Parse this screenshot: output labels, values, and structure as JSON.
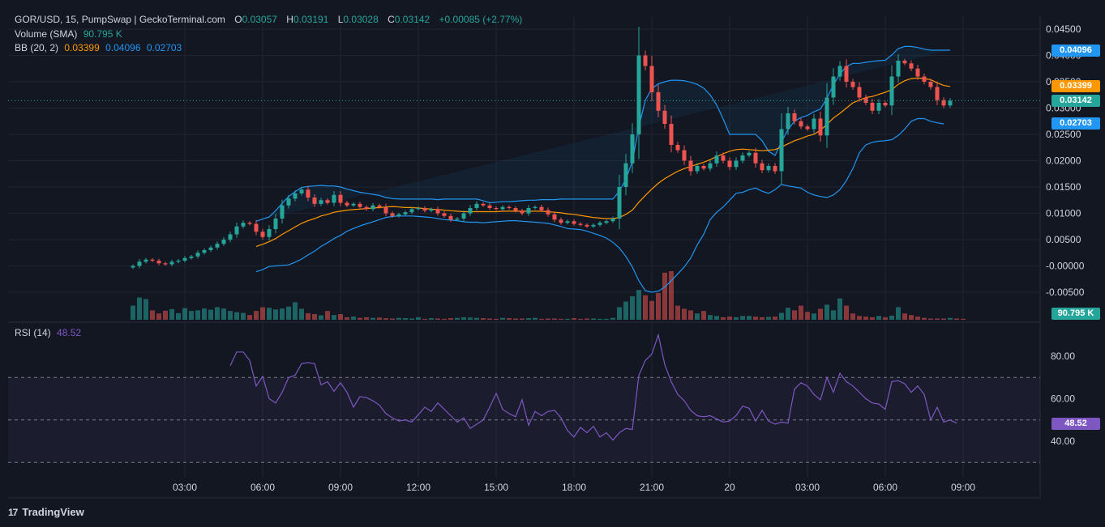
{
  "header": {
    "symbol": "GOR/USD, 15, PumpSwap | GeckoTerminal.com",
    "open_label": "O",
    "open": "0.03057",
    "high_label": "H",
    "high": "0.03191",
    "low_label": "L",
    "low": "0.03028",
    "close_label": "C",
    "close": "0.03142",
    "change": "+0.00085 (+2.77%)"
  },
  "volume_legend": {
    "label": "Volume (SMA)",
    "value": "90.795 K"
  },
  "bb_legend": {
    "label": "BB (20, 2)",
    "basis": "0.03399",
    "upper": "0.04096",
    "lower": "0.02703"
  },
  "rsi_legend": {
    "label": "RSI (14)",
    "value": "48.52"
  },
  "badges": {
    "upper": "0.04096",
    "basis": "0.03399",
    "last": "0.03142",
    "lower": "0.02703",
    "volume": "90.795 K",
    "rsi": "48.52"
  },
  "brand": {
    "name": "TradingView",
    "logo": "17"
  },
  "colors": {
    "up": "#26a69a",
    "down": "#ef5350",
    "bb_band": "#2196f3",
    "bb_basis": "#ff9800",
    "rsi": "#7e57c2",
    "background": "#131722",
    "grid": "#1f2433",
    "text": "#d1d4dc"
  },
  "chart_data": [
    {
      "type": "candlestick",
      "title": "GOR/USD, 15, PumpSwap | GeckoTerminal.com",
      "interval": "15m",
      "ylim": [
        -0.0065,
        0.0465
      ],
      "y_ticks": [
        "0.04500",
        "0.04000",
        "0.03500",
        "0.03000",
        "0.02500",
        "0.02000",
        "0.01500",
        "0.01000",
        "0.00500",
        "-0.00000",
        "-0.00500"
      ],
      "x_ticks": [
        "03:00",
        "06:00",
        "09:00",
        "12:00",
        "15:00",
        "18:00",
        "21:00",
        "20",
        "03:00",
        "06:00",
        "09:00"
      ],
      "x_tick_index": [
        8,
        20,
        32,
        44,
        56,
        68,
        80,
        92,
        104,
        116,
        128
      ],
      "close": [
        0.0,
        0.0008,
        0.0012,
        0.001,
        0.0005,
        0.0003,
        0.0008,
        0.001,
        0.0015,
        0.0018,
        0.0025,
        0.003,
        0.0035,
        0.0042,
        0.005,
        0.006,
        0.0075,
        0.0082,
        0.008,
        0.0065,
        0.0055,
        0.007,
        0.009,
        0.0115,
        0.0128,
        0.0138,
        0.0145,
        0.013,
        0.0118,
        0.0125,
        0.012,
        0.0135,
        0.012,
        0.0115,
        0.0118,
        0.0112,
        0.0108,
        0.0115,
        0.0112,
        0.01,
        0.0095,
        0.0098,
        0.0102,
        0.0108,
        0.011,
        0.0105,
        0.0108,
        0.01,
        0.0095,
        0.0088,
        0.009,
        0.01,
        0.011,
        0.0118,
        0.0115,
        0.011,
        0.0108,
        0.0112,
        0.011,
        0.0105,
        0.01,
        0.011,
        0.0112,
        0.0106,
        0.0098,
        0.0088,
        0.0082,
        0.0085,
        0.008,
        0.0078,
        0.0075,
        0.0078,
        0.0082,
        0.0085,
        0.009,
        0.015,
        0.0195,
        0.025,
        0.04,
        0.038,
        0.033,
        0.0295,
        0.027,
        0.023,
        0.022,
        0.02,
        0.018,
        0.019,
        0.0185,
        0.0195,
        0.021,
        0.02,
        0.0188,
        0.02,
        0.021,
        0.0215,
        0.0195,
        0.0182,
        0.019,
        0.018,
        0.026,
        0.029,
        0.0275,
        0.0265,
        0.026,
        0.028,
        0.0248,
        0.032,
        0.036,
        0.038,
        0.035,
        0.034,
        0.032,
        0.031,
        0.0295,
        0.031,
        0.0305,
        0.036,
        0.039,
        0.0385,
        0.0375,
        0.036,
        0.035,
        0.034,
        0.0315,
        0.0305,
        0.0314
      ],
      "volume": [
        45,
        71,
        66,
        30,
        20,
        29,
        34,
        21,
        37,
        28,
        30,
        36,
        32,
        40,
        36,
        28,
        24,
        22,
        15,
        28,
        40,
        38,
        33,
        36,
        42,
        56,
        35,
        21,
        18,
        14,
        28,
        15,
        18,
        8,
        10,
        6,
        8,
        6,
        7,
        5,
        4,
        6,
        5,
        4,
        8,
        3,
        5,
        4,
        3,
        5,
        6,
        8,
        7,
        6,
        5,
        4,
        3,
        6,
        5,
        4,
        4,
        5,
        6,
        3,
        4,
        4,
        3,
        3,
        5,
        3,
        4,
        4,
        3,
        3,
        6,
        40,
        58,
        75,
        95,
        78,
        60,
        85,
        150,
        155,
        45,
        35,
        30,
        20,
        28,
        15,
        12,
        8,
        10,
        8,
        12,
        12,
        10,
        8,
        9,
        10,
        22,
        38,
        30,
        45,
        25,
        20,
        35,
        48,
        30,
        68,
        45,
        20,
        12,
        10,
        8,
        12,
        8,
        13,
        40,
        20,
        15,
        10,
        6,
        4,
        4,
        4,
        6,
        4,
        3
      ],
      "bb_upper": [
        null,
        null,
        null,
        null,
        null,
        null,
        null,
        null,
        null,
        null,
        null,
        null,
        null,
        null,
        null,
        null,
        null,
        null,
        null,
        0.0085,
        0.0089,
        0.0093,
        0.0105,
        0.0119,
        0.0132,
        0.0141,
        0.0149,
        0.0151,
        0.0152,
        0.0153,
        0.0152,
        0.0152,
        0.015,
        0.0146,
        0.0143,
        0.014,
        0.0138,
        0.0136,
        0.0134,
        0.013,
        0.0128,
        0.0127,
        0.0127,
        0.0127,
        0.0127,
        0.0127,
        0.0127,
        0.0126,
        0.0127,
        0.0127,
        0.0127,
        0.0127,
        0.0127,
        0.0127,
        0.0124,
        0.012,
        0.0121,
        0.0122,
        0.0122,
        0.0123,
        0.0124,
        0.0125,
        0.0125,
        0.0126,
        0.0126,
        0.0126,
        0.0127,
        0.0127,
        0.0127,
        0.0127,
        0.0127,
        0.0127,
        0.0127,
        0.0127,
        0.0127,
        0.0142,
        0.0165,
        0.0198,
        0.0264,
        0.0315,
        0.0337,
        0.0346,
        0.035,
        0.0353,
        0.0353,
        0.0352,
        0.0349,
        0.0345,
        0.0338,
        0.0325,
        0.0306,
        0.0279,
        0.025,
        0.025,
        0.025,
        0.025,
        0.025,
        0.0238,
        0.0218,
        0.021,
        0.0236,
        0.0259,
        0.0275,
        0.0282,
        0.0286,
        0.0293,
        0.0298,
        0.0319,
        0.0344,
        0.0365,
        0.0379,
        0.0385,
        0.0385,
        0.0387,
        0.0389,
        0.039,
        0.0391,
        0.0401,
        0.0413,
        0.0417,
        0.0417,
        0.0415,
        0.0412,
        0.041,
        0.041,
        0.041,
        0.041
      ],
      "bb_basis": [
        null,
        null,
        null,
        null,
        null,
        null,
        null,
        null,
        null,
        null,
        null,
        null,
        null,
        null,
        null,
        null,
        null,
        null,
        null,
        0.0037,
        0.0041,
        0.0046,
        0.0052,
        0.006,
        0.0067,
        0.0074,
        0.0081,
        0.0086,
        0.009,
        0.0095,
        0.0098,
        0.0102,
        0.0104,
        0.0106,
        0.0107,
        0.0108,
        0.0109,
        0.011,
        0.0111,
        0.0112,
        0.0113,
        0.0112,
        0.0111,
        0.0111,
        0.011,
        0.0109,
        0.0108,
        0.0107,
        0.0106,
        0.0105,
        0.0104,
        0.0103,
        0.0103,
        0.0103,
        0.0103,
        0.0103,
        0.0103,
        0.0104,
        0.0104,
        0.0104,
        0.0104,
        0.0104,
        0.0104,
        0.0104,
        0.0103,
        0.0102,
        0.0101,
        0.0099,
        0.0098,
        0.0096,
        0.0094,
        0.0092,
        0.0091,
        0.009,
        0.009,
        0.0092,
        0.0098,
        0.0106,
        0.0121,
        0.0134,
        0.0146,
        0.0157,
        0.0166,
        0.0173,
        0.018,
        0.0185,
        0.0189,
        0.0193,
        0.0197,
        0.0202,
        0.0208,
        0.0213,
        0.0218,
        0.0221,
        0.0222,
        0.0221,
        0.022,
        0.0219,
        0.022,
        0.0221,
        0.0226,
        0.0232,
        0.0238,
        0.0242,
        0.0247,
        0.025,
        0.0258,
        0.0269,
        0.0281,
        0.029,
        0.03,
        0.031,
        0.0315,
        0.032,
        0.0322,
        0.0326,
        0.033,
        0.0335,
        0.0345,
        0.0352,
        0.0356,
        0.0357,
        0.0356,
        0.0354,
        0.0348,
        0.0343,
        0.0341
      ],
      "bb_lower": [
        null,
        null,
        null,
        null,
        null,
        null,
        null,
        null,
        null,
        null,
        null,
        null,
        null,
        null,
        null,
        null,
        null,
        null,
        null,
        -0.0011,
        -0.0007,
        -0.0001,
        0.0,
        0.0001,
        0.0002,
        0.0007,
        0.0013,
        0.0021,
        0.0028,
        0.0037,
        0.0044,
        0.0052,
        0.0058,
        0.0066,
        0.0071,
        0.0076,
        0.008,
        0.0084,
        0.0088,
        0.0092,
        0.0094,
        0.0095,
        0.0095,
        0.0095,
        0.0094,
        0.0093,
        0.0092,
        0.009,
        0.0088,
        0.0087,
        0.0086,
        0.0084,
        0.0083,
        0.0083,
        0.0082,
        0.0083,
        0.0084,
        0.0085,
        0.0086,
        0.0086,
        0.0085,
        0.0084,
        0.0083,
        0.0082,
        0.0081,
        0.0078,
        0.0075,
        0.0071,
        0.007,
        0.0069,
        0.0066,
        0.0062,
        0.0058,
        0.0053,
        0.0045,
        0.0034,
        0.0018,
        -0.0002,
        -0.0028,
        -0.0047,
        -0.005,
        -0.0048,
        -0.004,
        -0.0028,
        -0.0015,
        -0.0002,
        0.0015,
        0.004,
        0.006,
        0.0088,
        0.0102,
        0.0112,
        0.0125,
        0.0138,
        0.014,
        0.0145,
        0.0148,
        0.0142,
        0.0138,
        0.0145,
        0.0155,
        0.0152,
        0.015,
        0.0148,
        0.014,
        0.0135,
        0.0132,
        0.013,
        0.0135,
        0.0145,
        0.0162,
        0.0185,
        0.0215,
        0.023,
        0.0235,
        0.0237,
        0.0238,
        0.024,
        0.0248,
        0.026,
        0.0275,
        0.028,
        0.028,
        0.0275,
        0.0272,
        0.027
      ]
    },
    {
      "type": "line",
      "title": "RSI (14)",
      "ylim": [
        22.5,
        91.5
      ],
      "y_ticks": [
        "80.00",
        "60.00",
        "40.00"
      ],
      "bands": [
        30,
        50,
        70
      ],
      "values": [
        null,
        null,
        null,
        null,
        null,
        null,
        null,
        null,
        null,
        null,
        null,
        null,
        null,
        null,
        null,
        75.5,
        82.0,
        82.0,
        78.0,
        66.0,
        70.5,
        60.0,
        58.0,
        63.0,
        70.0,
        71.0,
        76.5,
        77.0,
        76.5,
        66.5,
        68.0,
        63.5,
        67.5,
        63.0,
        56.0,
        61.0,
        60.5,
        59.0,
        57.0,
        53.0,
        51.0,
        49.5,
        50.0,
        49.0,
        52.5,
        56.0,
        54.0,
        58.0,
        55.0,
        52.0,
        49.0,
        51.0,
        46.0,
        48.0,
        50.0,
        56.0,
        62.5,
        55.0,
        53.0,
        51.5,
        59.5,
        47.5,
        54.0,
        52.0,
        54.0,
        54.5,
        51.0,
        45.0,
        42.0,
        46.5,
        44.0,
        47.0,
        42.0,
        44.0,
        40.5,
        44.0,
        46.0,
        45.5,
        71.0,
        78.0,
        81.0,
        90.0,
        76.0,
        68.0,
        62.0,
        59.0,
        54.5,
        52.0,
        51.5,
        52.0,
        50.5,
        49.0,
        49.5,
        52.0,
        56.5,
        55.5,
        49.5,
        54.5,
        49.5,
        48.0,
        49.0,
        48.5,
        64.5,
        67.5,
        66.0,
        62.0,
        59.5,
        70.0,
        63.0,
        72.0,
        68.0,
        66.0,
        63.0,
        60.0,
        58.0,
        57.5,
        55.0,
        68.0,
        68.5,
        67.0,
        63.0,
        66.0,
        62.0,
        50.0,
        56.0,
        49.0,
        50.0,
        48.5
      ]
    }
  ]
}
